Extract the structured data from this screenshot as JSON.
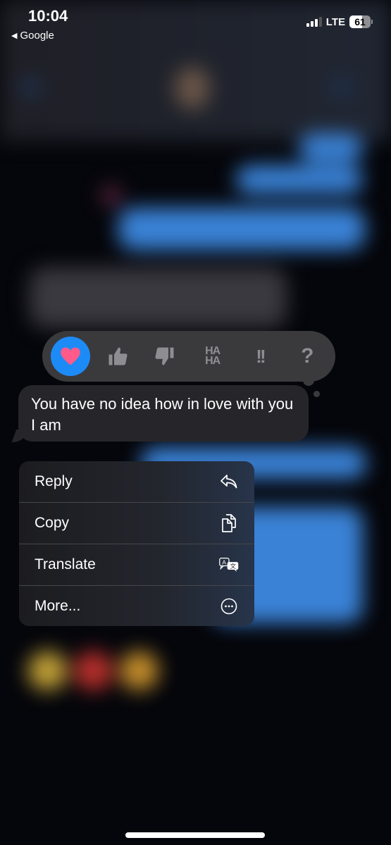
{
  "status_bar": {
    "time": "10:04",
    "back_app": "Google",
    "network": "LTE",
    "battery_level": "61",
    "battery_percent": 61,
    "signal_bars_active": 3,
    "signal_bars_total": 4
  },
  "tapback": {
    "items": [
      {
        "name": "heart",
        "label": "♥",
        "selected": true
      },
      {
        "name": "thumbs-up",
        "label": "👍",
        "selected": false
      },
      {
        "name": "thumbs-down",
        "label": "👎",
        "selected": false
      },
      {
        "name": "haha",
        "label": "HA\nHA",
        "selected": false
      },
      {
        "name": "exclamation",
        "label": "!!",
        "selected": false
      },
      {
        "name": "question",
        "label": "?",
        "selected": false
      }
    ],
    "colors": {
      "selected_bg": "#1d8bf6",
      "heart": "#ff5a8a",
      "icon": "#8d8d92"
    }
  },
  "message": {
    "text": "You have no idea how in love with you I am"
  },
  "context_menu": {
    "items": [
      {
        "label": "Reply",
        "icon": "reply-icon"
      },
      {
        "label": "Copy",
        "icon": "copy-icon"
      },
      {
        "label": "Translate",
        "icon": "translate-icon"
      },
      {
        "label": "More...",
        "icon": "more-icon"
      }
    ]
  }
}
